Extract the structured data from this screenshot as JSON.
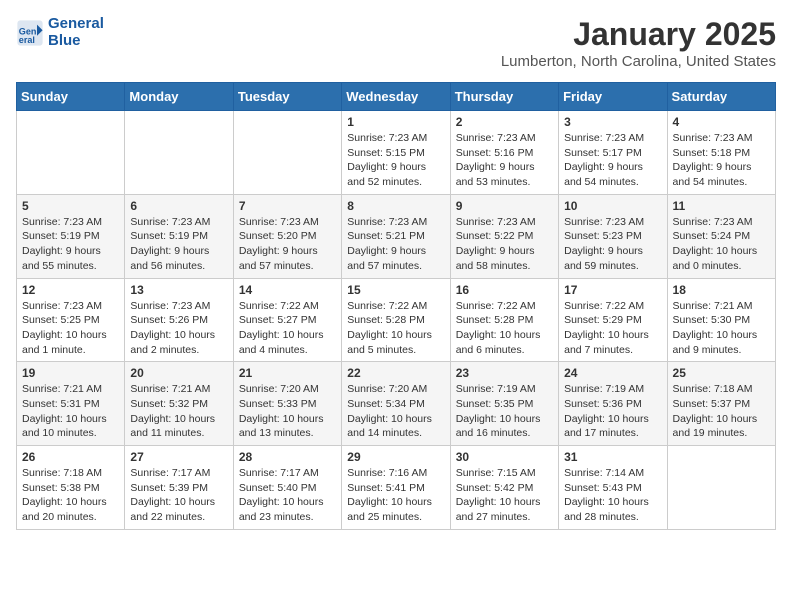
{
  "header": {
    "logo_line1": "General",
    "logo_line2": "Blue",
    "month": "January 2025",
    "location": "Lumberton, North Carolina, United States"
  },
  "weekdays": [
    "Sunday",
    "Monday",
    "Tuesday",
    "Wednesday",
    "Thursday",
    "Friday",
    "Saturday"
  ],
  "weeks": [
    [
      {
        "day": "",
        "info": ""
      },
      {
        "day": "",
        "info": ""
      },
      {
        "day": "",
        "info": ""
      },
      {
        "day": "1",
        "info": "Sunrise: 7:23 AM\nSunset: 5:15 PM\nDaylight: 9 hours and 52 minutes."
      },
      {
        "day": "2",
        "info": "Sunrise: 7:23 AM\nSunset: 5:16 PM\nDaylight: 9 hours and 53 minutes."
      },
      {
        "day": "3",
        "info": "Sunrise: 7:23 AM\nSunset: 5:17 PM\nDaylight: 9 hours and 54 minutes."
      },
      {
        "day": "4",
        "info": "Sunrise: 7:23 AM\nSunset: 5:18 PM\nDaylight: 9 hours and 54 minutes."
      }
    ],
    [
      {
        "day": "5",
        "info": "Sunrise: 7:23 AM\nSunset: 5:19 PM\nDaylight: 9 hours and 55 minutes."
      },
      {
        "day": "6",
        "info": "Sunrise: 7:23 AM\nSunset: 5:19 PM\nDaylight: 9 hours and 56 minutes."
      },
      {
        "day": "7",
        "info": "Sunrise: 7:23 AM\nSunset: 5:20 PM\nDaylight: 9 hours and 57 minutes."
      },
      {
        "day": "8",
        "info": "Sunrise: 7:23 AM\nSunset: 5:21 PM\nDaylight: 9 hours and 57 minutes."
      },
      {
        "day": "9",
        "info": "Sunrise: 7:23 AM\nSunset: 5:22 PM\nDaylight: 9 hours and 58 minutes."
      },
      {
        "day": "10",
        "info": "Sunrise: 7:23 AM\nSunset: 5:23 PM\nDaylight: 9 hours and 59 minutes."
      },
      {
        "day": "11",
        "info": "Sunrise: 7:23 AM\nSunset: 5:24 PM\nDaylight: 10 hours and 0 minutes."
      }
    ],
    [
      {
        "day": "12",
        "info": "Sunrise: 7:23 AM\nSunset: 5:25 PM\nDaylight: 10 hours and 1 minute."
      },
      {
        "day": "13",
        "info": "Sunrise: 7:23 AM\nSunset: 5:26 PM\nDaylight: 10 hours and 2 minutes."
      },
      {
        "day": "14",
        "info": "Sunrise: 7:22 AM\nSunset: 5:27 PM\nDaylight: 10 hours and 4 minutes."
      },
      {
        "day": "15",
        "info": "Sunrise: 7:22 AM\nSunset: 5:28 PM\nDaylight: 10 hours and 5 minutes."
      },
      {
        "day": "16",
        "info": "Sunrise: 7:22 AM\nSunset: 5:28 PM\nDaylight: 10 hours and 6 minutes."
      },
      {
        "day": "17",
        "info": "Sunrise: 7:22 AM\nSunset: 5:29 PM\nDaylight: 10 hours and 7 minutes."
      },
      {
        "day": "18",
        "info": "Sunrise: 7:21 AM\nSunset: 5:30 PM\nDaylight: 10 hours and 9 minutes."
      }
    ],
    [
      {
        "day": "19",
        "info": "Sunrise: 7:21 AM\nSunset: 5:31 PM\nDaylight: 10 hours and 10 minutes."
      },
      {
        "day": "20",
        "info": "Sunrise: 7:21 AM\nSunset: 5:32 PM\nDaylight: 10 hours and 11 minutes."
      },
      {
        "day": "21",
        "info": "Sunrise: 7:20 AM\nSunset: 5:33 PM\nDaylight: 10 hours and 13 minutes."
      },
      {
        "day": "22",
        "info": "Sunrise: 7:20 AM\nSunset: 5:34 PM\nDaylight: 10 hours and 14 minutes."
      },
      {
        "day": "23",
        "info": "Sunrise: 7:19 AM\nSunset: 5:35 PM\nDaylight: 10 hours and 16 minutes."
      },
      {
        "day": "24",
        "info": "Sunrise: 7:19 AM\nSunset: 5:36 PM\nDaylight: 10 hours and 17 minutes."
      },
      {
        "day": "25",
        "info": "Sunrise: 7:18 AM\nSunset: 5:37 PM\nDaylight: 10 hours and 19 minutes."
      }
    ],
    [
      {
        "day": "26",
        "info": "Sunrise: 7:18 AM\nSunset: 5:38 PM\nDaylight: 10 hours and 20 minutes."
      },
      {
        "day": "27",
        "info": "Sunrise: 7:17 AM\nSunset: 5:39 PM\nDaylight: 10 hours and 22 minutes."
      },
      {
        "day": "28",
        "info": "Sunrise: 7:17 AM\nSunset: 5:40 PM\nDaylight: 10 hours and 23 minutes."
      },
      {
        "day": "29",
        "info": "Sunrise: 7:16 AM\nSunset: 5:41 PM\nDaylight: 10 hours and 25 minutes."
      },
      {
        "day": "30",
        "info": "Sunrise: 7:15 AM\nSunset: 5:42 PM\nDaylight: 10 hours and 27 minutes."
      },
      {
        "day": "31",
        "info": "Sunrise: 7:14 AM\nSunset: 5:43 PM\nDaylight: 10 hours and 28 minutes."
      },
      {
        "day": "",
        "info": ""
      }
    ]
  ]
}
